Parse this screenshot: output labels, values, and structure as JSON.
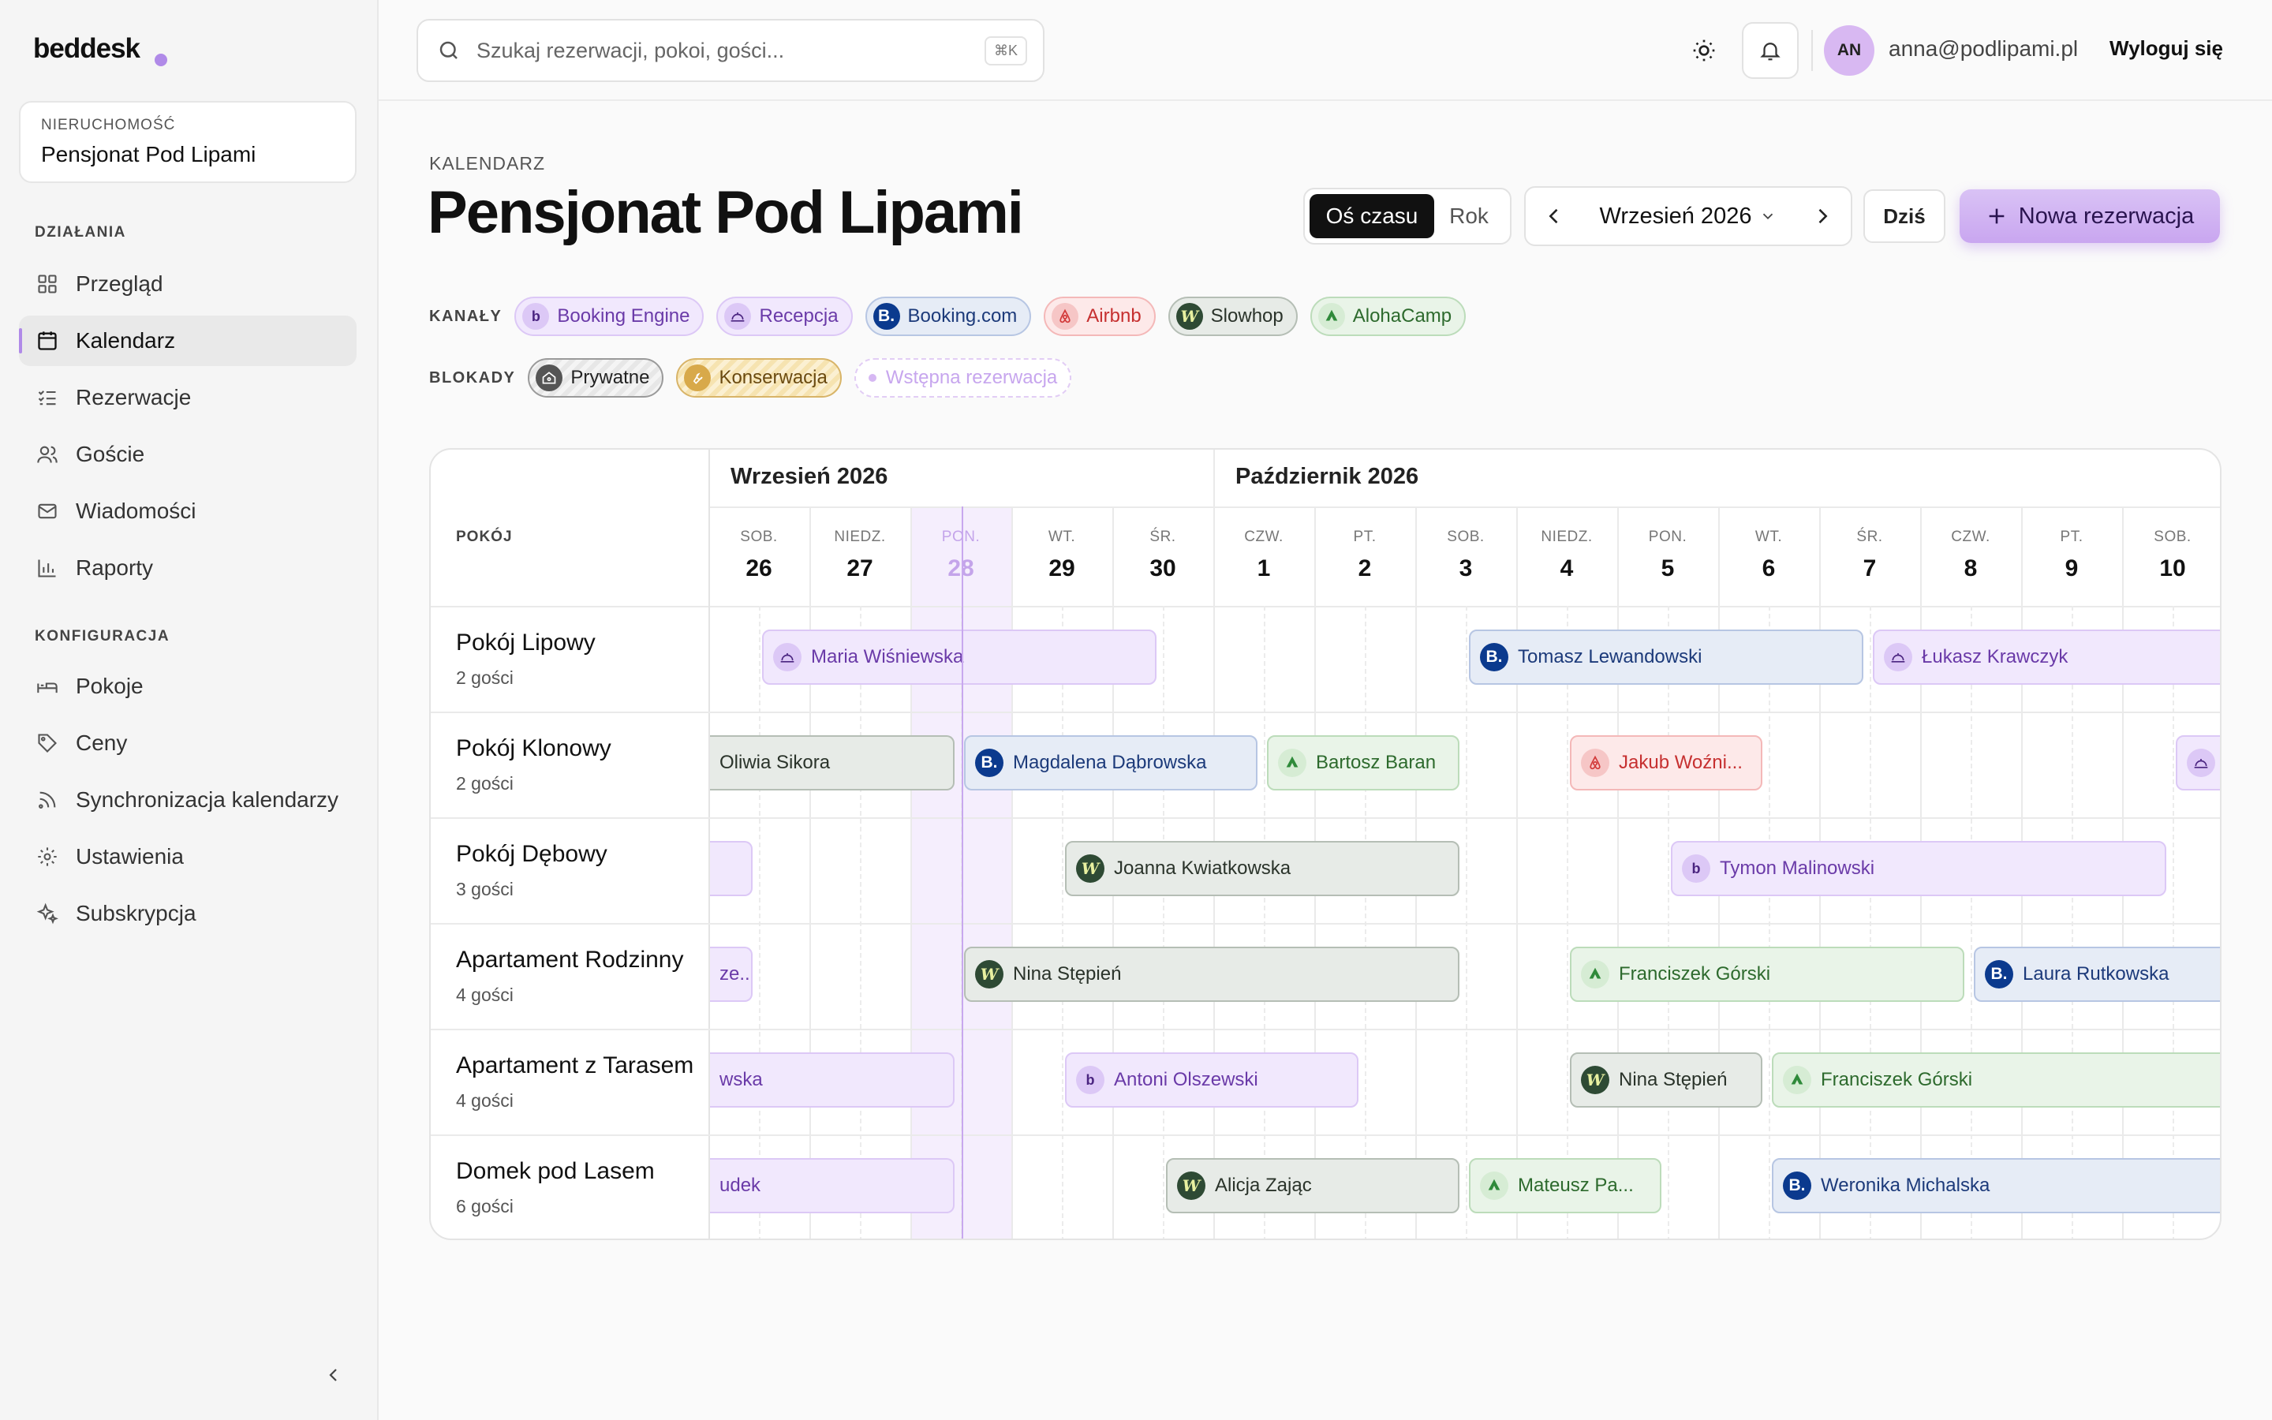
{
  "sidebar": {
    "logo": "beddesk",
    "property_label": "NIERUCHOMOŚĆ",
    "property_name": "Pensjonat Pod Lipami",
    "section_actions": "DZIAŁANIA",
    "section_config": "KONFIGURACJA",
    "items": [
      {
        "label": "Przegląd",
        "icon": "grid-icon"
      },
      {
        "label": "Kalendarz",
        "icon": "calendar-icon"
      },
      {
        "label": "Rezerwacje",
        "icon": "list-check-icon"
      },
      {
        "label": "Goście",
        "icon": "users-icon"
      },
      {
        "label": "Wiadomości",
        "icon": "mail-icon"
      },
      {
        "label": "Raporty",
        "icon": "bar-chart-icon"
      },
      {
        "label": "Pokoje",
        "icon": "bed-icon"
      },
      {
        "label": "Ceny",
        "icon": "tag-icon"
      },
      {
        "label": "Synchronizacja kalendarzy",
        "icon": "rss-icon"
      },
      {
        "label": "Ustawienia",
        "icon": "gear-icon"
      },
      {
        "label": "Subskrypcja",
        "icon": "sparkle-icon"
      }
    ],
    "active": "Kalendarz"
  },
  "topbar": {
    "search_placeholder": "Szukaj rezerwacji, pokoi, gości...",
    "shortcut": "⌘K",
    "avatar_initials": "AN",
    "user_email": "anna@podlipami.pl",
    "logout": "Wyloguj się"
  },
  "header": {
    "breadcrumb": "KALENDARZ",
    "title": "Pensjonat Pod Lipami",
    "view_timeline": "Oś czasu",
    "view_year": "Rok",
    "month": "Wrzesień 2026",
    "today": "Dziś",
    "new_reservation": "Nowa rezerwacja"
  },
  "legend": {
    "channels_label": "KANAŁY",
    "blocks_label": "BLOKADY",
    "channels": [
      {
        "key": "be",
        "label": "Booking Engine"
      },
      {
        "key": "rec",
        "label": "Recepcja"
      },
      {
        "key": "bk",
        "label": "Booking.com"
      },
      {
        "key": "ab",
        "label": "Airbnb"
      },
      {
        "key": "sl",
        "label": "Slowhop"
      },
      {
        "key": "al",
        "label": "AlohaCamp"
      }
    ],
    "blocks": [
      {
        "key": "pr",
        "label": "Prywatne"
      },
      {
        "key": "ko",
        "label": "Konserwacja"
      },
      {
        "key": "ws",
        "label": "Wstępna rezerwacja"
      }
    ]
  },
  "colors": {
    "accent": "#b08ae8",
    "be": {
      "bg": "#f1e8fd",
      "border": "#dcc8f6",
      "text": "#6a3aa8",
      "badge": "#dcc8f6",
      "fg": "#4a2480"
    },
    "rec": {
      "bg": "#f1e8fd",
      "border": "#dcc8f6",
      "text": "#6a3aa8",
      "badge": "#dcc8f6",
      "fg": "#4a2480"
    },
    "bk": {
      "bg": "#e6ecf6",
      "border": "#b7c6e3",
      "text": "#1c3a7a",
      "badge": "#0b3a8e",
      "fg": "#ffffff"
    },
    "ab": {
      "bg": "#fde9e9",
      "border": "#f4b8b8",
      "text": "#c63030",
      "badge": "#f6c6c6",
      "fg": "#d23838"
    },
    "sl": {
      "bg": "#e7ebe7",
      "border": "#b5beb5",
      "text": "#2a332a",
      "badge": "#2e4a34",
      "fg": "#e8f0a0"
    },
    "al": {
      "bg": "#e9f4e8",
      "border": "#bcdcba",
      "text": "#2d6a2d",
      "badge": "#d6ecd4",
      "fg": "#2f8a3a"
    },
    "pr": {
      "bg": "#ececec",
      "border": "#9a9a9a",
      "text": "#222222",
      "badge": "#555555",
      "fg": "#ffffff"
    },
    "ko": {
      "bg": "#faecc8",
      "border": "#d8b468",
      "text": "#6a4a10",
      "badge": "#d8a94a",
      "fg": "#ffffff"
    },
    "ws": {
      "bg": "#ffffff",
      "border": "#e2cdf5",
      "text": "#c7a6ee",
      "badge": "#d6b8f3",
      "fg": "#ffffff"
    }
  },
  "calendar": {
    "room_header": "POKÓJ",
    "months": [
      {
        "label": "Wrzesień 2026"
      },
      {
        "label": "Październik 2026"
      }
    ],
    "days": [
      {
        "dow": "SOB.",
        "num": "26"
      },
      {
        "dow": "NIEDZ.",
        "num": "27"
      },
      {
        "dow": "PON.",
        "num": "28",
        "today": true
      },
      {
        "dow": "WT.",
        "num": "29"
      },
      {
        "dow": "ŚR.",
        "num": "30"
      },
      {
        "dow": "CZW.",
        "num": "1"
      },
      {
        "dow": "PT.",
        "num": "2"
      },
      {
        "dow": "SOB.",
        "num": "3"
      },
      {
        "dow": "NIEDZ.",
        "num": "4"
      },
      {
        "dow": "PON.",
        "num": "5"
      },
      {
        "dow": "WT.",
        "num": "6"
      },
      {
        "dow": "ŚR.",
        "num": "7"
      },
      {
        "dow": "CZW.",
        "num": "8"
      },
      {
        "dow": "PT.",
        "num": "9"
      },
      {
        "dow": "SOB.",
        "num": "10"
      }
    ],
    "rooms": [
      {
        "name": "Pokój Lipowy",
        "guests": "2 gości",
        "bookings": [
          {
            "guest": "Maria Wiśniewska",
            "channel": "rec",
            "start": "2026-09-26",
            "nights": 4
          },
          {
            "guest": "Tomasz Lewandowski",
            "channel": "bk",
            "start": "2026-10-03",
            "nights": 4
          },
          {
            "guest": "Łukasz Krawczyk",
            "channel": "rec",
            "start": "2026-10-07",
            "nights": 4
          }
        ]
      },
      {
        "name": "Pokój Klonowy",
        "guests": "2 gości",
        "bookings": [
          {
            "guest": "Oliwia Sikora",
            "channel": "sl",
            "start": "2026-09-24",
            "nights": 4
          },
          {
            "guest": "Magdalena Dąbrowska",
            "channel": "bk",
            "start": "2026-09-28",
            "nights": 3
          },
          {
            "guest": "Bartosz Baran",
            "channel": "al",
            "start": "2026-10-01",
            "nights": 2
          },
          {
            "guest": "Jakub Woźni...",
            "channel": "ab",
            "start": "2026-10-04",
            "nights": 2
          },
          {
            "guest": "",
            "channel": "rec",
            "start": "2026-10-10",
            "nights": 2
          }
        ]
      },
      {
        "name": "Pokój Dębowy",
        "guests": "3 gości",
        "bookings": [
          {
            "guest": "",
            "channel": "rec",
            "start": "2026-09-24",
            "nights": 2
          },
          {
            "guest": "Joanna Kwiatkowska",
            "channel": "sl",
            "start": "2026-09-29",
            "nights": 4
          },
          {
            "guest": "Tymon Malinowski",
            "channel": "be",
            "start": "2026-10-05",
            "nights": 5
          }
        ]
      },
      {
        "name": "Apartament Rodzinny",
        "guests": "4 gości",
        "bookings": [
          {
            "guest": "...ze...",
            "channel": "rec",
            "start": "2026-09-24",
            "nights": 2
          },
          {
            "guest": "Nina Stępień",
            "channel": "sl",
            "start": "2026-09-28",
            "nights": 5
          },
          {
            "guest": "Franciszek Górski",
            "channel": "al",
            "start": "2026-10-04",
            "nights": 4
          },
          {
            "guest": "Laura Rutkowska",
            "channel": "bk",
            "start": "2026-10-08",
            "nights": 3
          }
        ]
      },
      {
        "name": "Apartament z Tarasem",
        "guests": "4 gości",
        "bookings": [
          {
            "guest": "...wska",
            "channel": "rec",
            "start": "2026-09-24",
            "nights": 4
          },
          {
            "guest": "Antoni Olszewski",
            "channel": "be",
            "start": "2026-09-29",
            "nights": 3
          },
          {
            "guest": "Nina Stępień",
            "channel": "sl",
            "start": "2026-10-04",
            "nights": 2
          },
          {
            "guest": "Franciszek Górski",
            "channel": "al",
            "start": "2026-10-06",
            "nights": 5
          }
        ]
      },
      {
        "name": "Domek pod Lasem",
        "guests": "6 gości",
        "bookings": [
          {
            "guest": "...udek",
            "channel": "rec",
            "start": "2026-09-24",
            "nights": 4
          },
          {
            "guest": "Alicja Zając",
            "channel": "sl",
            "start": "2026-09-30",
            "nights": 3
          },
          {
            "guest": "Mateusz Pa...",
            "channel": "al",
            "start": "2026-10-03",
            "nights": 2
          },
          {
            "guest": "Weronika Michalska",
            "channel": "bk",
            "start": "2026-10-06",
            "nights": 5
          }
        ]
      }
    ]
  }
}
